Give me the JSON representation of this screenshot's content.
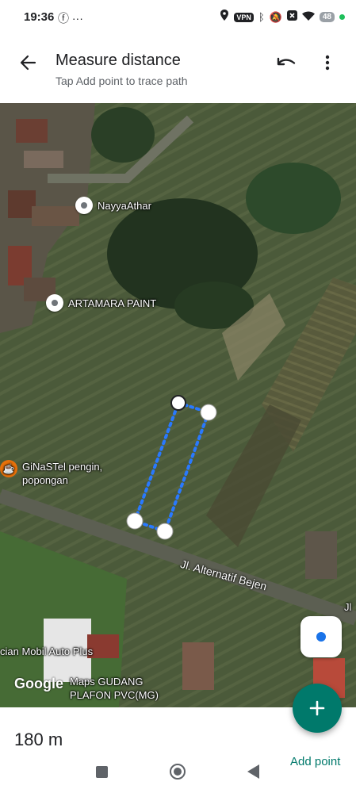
{
  "status": {
    "time": "19:36",
    "vpn": "VPN",
    "battery": "48"
  },
  "header": {
    "title": "Measure distance",
    "subtitle": "Tap Add point to trace path"
  },
  "map": {
    "places": [
      {
        "name": "NayyaAthar"
      },
      {
        "name": "ARTAMARA PAINT"
      },
      {
        "name_line1": "GiNaSTel pengin,",
        "name_line2": "popongan"
      },
      {
        "name": "cian Mobil Auto Plus"
      },
      {
        "name_line1": "Maps GUDANG",
        "name_line2": "PLAFON PVC(MG)"
      }
    ],
    "road_label": "Jl. Alternatif Bejen",
    "road_label_edge": "Jl",
    "google": "Google"
  },
  "bottom": {
    "distance": "180 m",
    "add_point": "Add point"
  },
  "colors": {
    "accent": "#00796b",
    "path": "#2979ff"
  }
}
